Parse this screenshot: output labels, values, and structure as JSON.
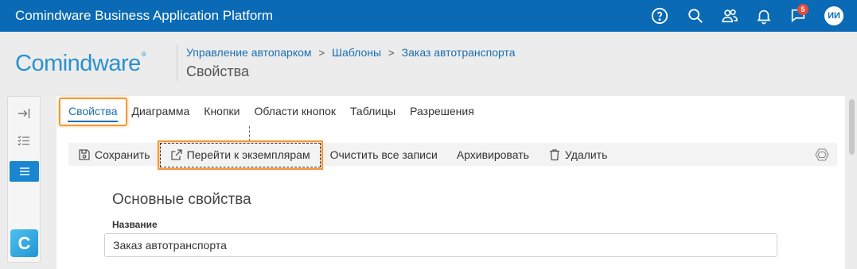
{
  "topbar": {
    "title": "Comindware Business Application Platform",
    "icons": [
      "help-icon",
      "search-icon",
      "users-icon",
      "bell-icon",
      "flag-icon",
      "avatar"
    ],
    "flag_badge": "5",
    "avatar_initials": "ИИ"
  },
  "header": {
    "logo_text": "Comindware",
    "logo_mark": "®",
    "breadcrumb": [
      "Управление автопарком",
      "Шаблоны",
      "Заказ автотранспорта"
    ],
    "breadcrumb_sep": ">",
    "title": "Свойства"
  },
  "left_rail": {
    "icons": [
      "collapse-icon",
      "checklist-icon",
      "list-icon"
    ],
    "app_logo_letter": "C"
  },
  "tabs": [
    {
      "label": "Свойства",
      "active": true
    },
    {
      "label": "Диаграмма",
      "active": false
    },
    {
      "label": "Кнопки",
      "active": false
    },
    {
      "label": "Области кнопок",
      "active": false
    },
    {
      "label": "Таблицы",
      "active": false
    },
    {
      "label": "Разрешения",
      "active": false
    }
  ],
  "toolbar": {
    "save_label": "Сохранить",
    "goto_instances_label": "Перейти к экземплярам",
    "clear_records_label": "Очистить все записи",
    "archive_label": "Архивировать",
    "delete_label": "Удалить",
    "settings_icon": "settings-hex-icon"
  },
  "form": {
    "section_title": "Основные свойства",
    "name_label": "Название",
    "name_value": "Заказ автотранспорта"
  },
  "colors": {
    "topbar": "#0a6ab5",
    "accent": "#1b6fb3",
    "highlight": "#f59833",
    "badge": "#e34b3c"
  }
}
